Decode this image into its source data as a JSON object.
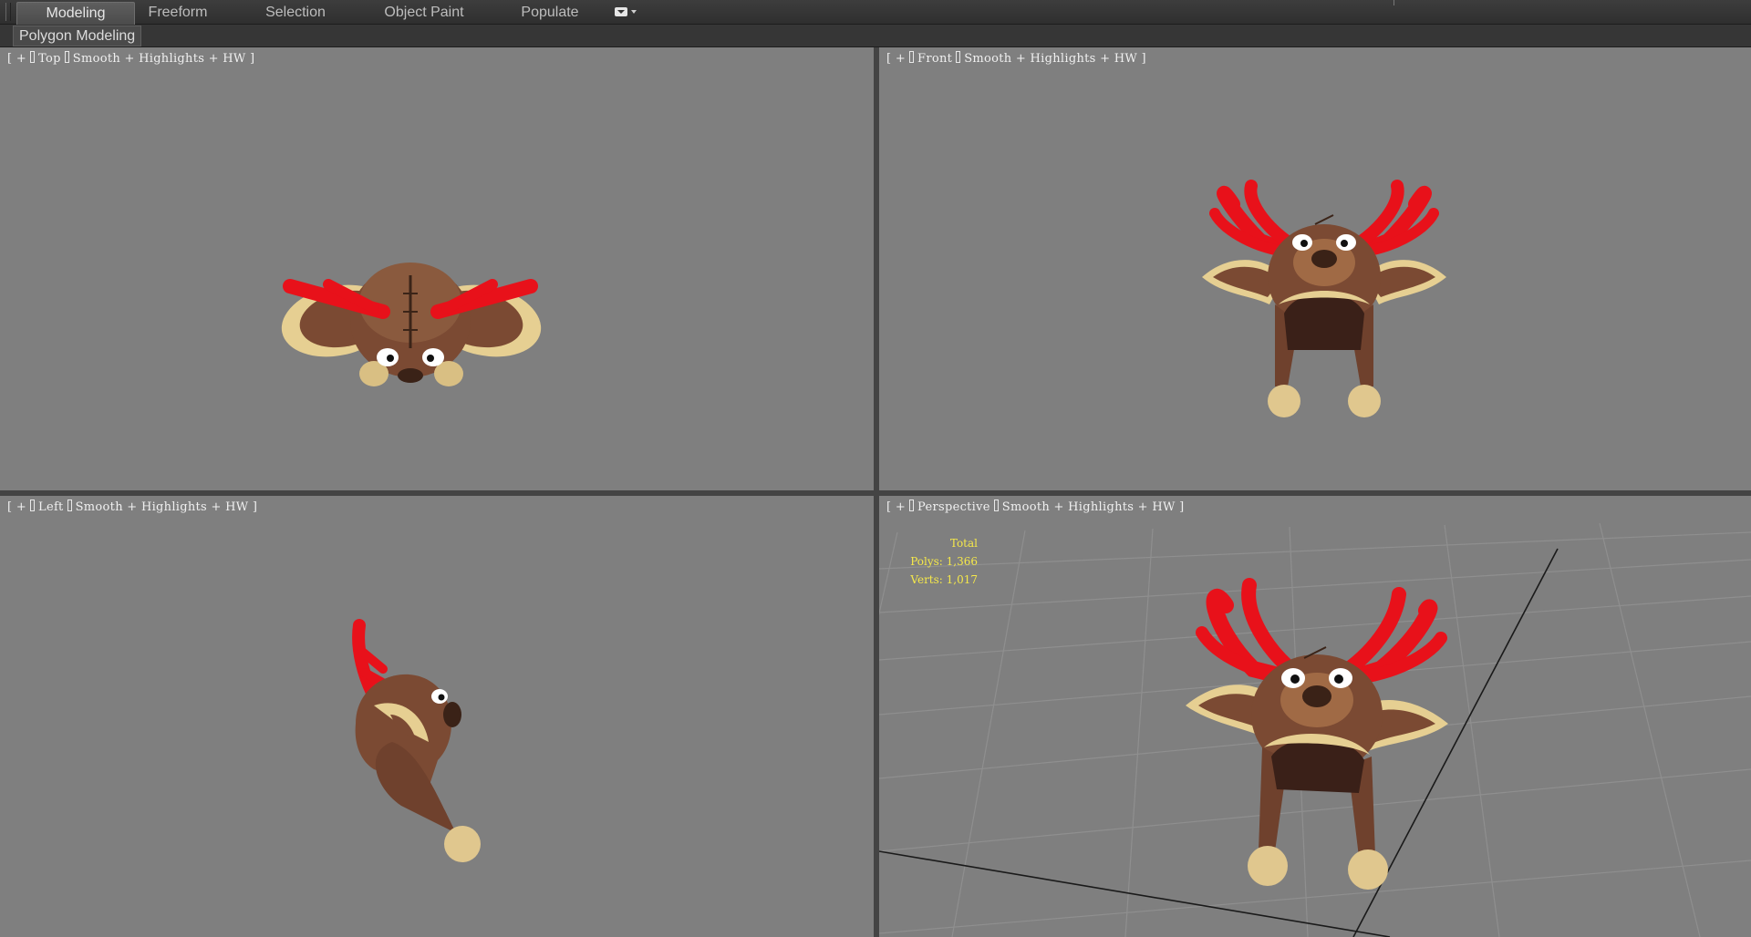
{
  "ribbon": {
    "tabs": [
      {
        "label": "Modeling",
        "active": true
      },
      {
        "label": "Freeform",
        "active": false
      },
      {
        "label": "Selection",
        "active": false
      },
      {
        "label": "Object Paint",
        "active": false
      },
      {
        "label": "Populate",
        "active": false
      }
    ],
    "panel_label": "Polygon Modeling"
  },
  "viewports": {
    "top": {
      "bracket_open": "[",
      "plus": "+",
      "view": "Top",
      "shading": "Smooth",
      "extra1": "Highlights",
      "extra2": "HW",
      "bracket_close": "]"
    },
    "front": {
      "bracket_open": "[",
      "plus": "+",
      "view": "Front",
      "shading": "Smooth",
      "extra1": "Highlights",
      "extra2": "HW",
      "bracket_close": "]"
    },
    "left": {
      "bracket_open": "[",
      "plus": "+",
      "view": "Left",
      "shading": "Smooth",
      "extra1": "Highlights",
      "extra2": "HW",
      "bracket_close": "]"
    },
    "perspective": {
      "bracket_open": "[",
      "plus": "+",
      "view": "Perspective",
      "shading": "Smooth",
      "extra1": "Highlights",
      "extra2": "HW",
      "bracket_close": "]"
    }
  },
  "stats": {
    "title": "Total",
    "polys": "Polys: 1,366",
    "verts": "Verts: 1,017"
  },
  "colors": {
    "viewport_bg": "#7f7f7f",
    "antler": "#e8111a",
    "fur": "#7b4a33",
    "fur_light": "#e6cf92",
    "stats_text": "#f5e84a"
  }
}
